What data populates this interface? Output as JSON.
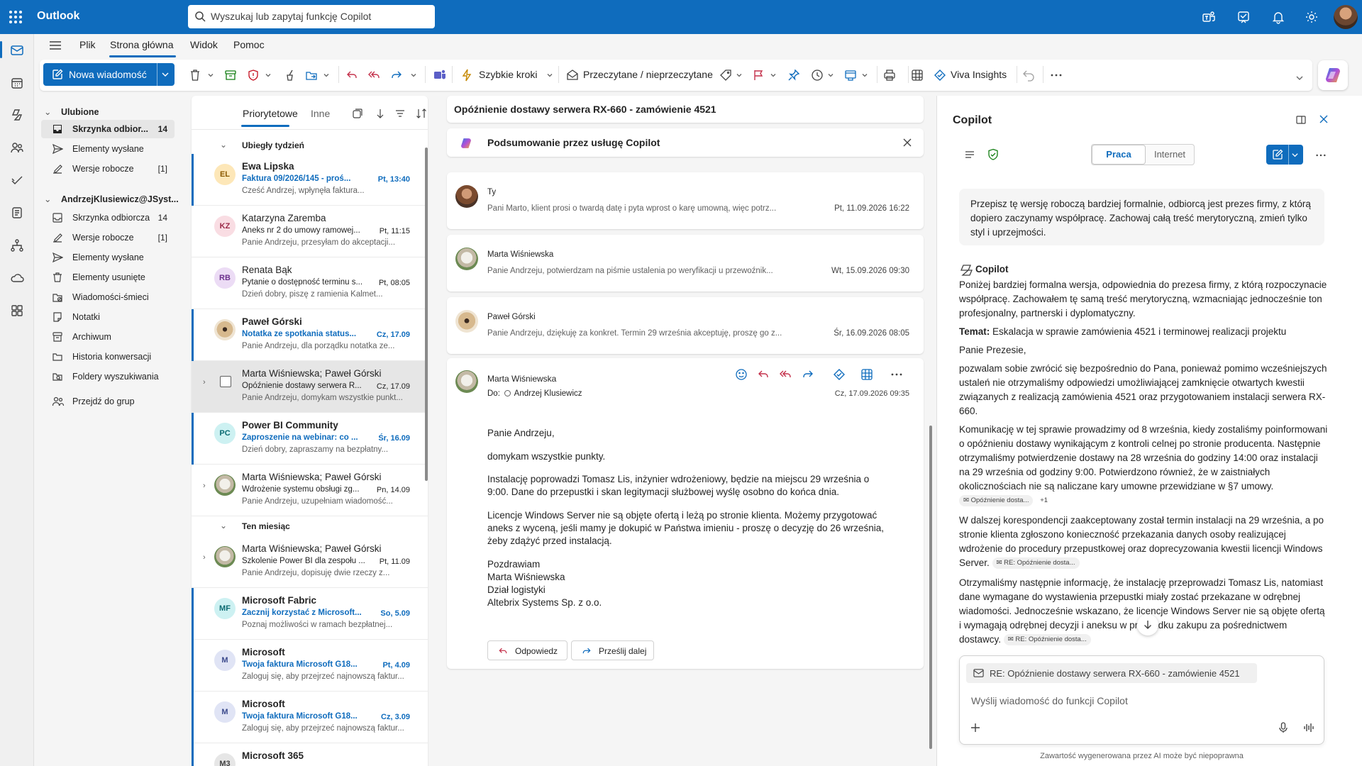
{
  "app": {
    "title": "Outlook"
  },
  "search": {
    "placeholder": "Wyszukaj lub zapytaj funkcję Copilot"
  },
  "menu": {
    "items": [
      "Plik",
      "Strona główna",
      "Widok",
      "Pomoc"
    ],
    "active": "Strona główna"
  },
  "ribbon": {
    "new_message": "Nowa wiadomość",
    "quick_steps": "Szybkie kroki",
    "read_unread": "Przeczytane / nieprzeczytane",
    "viva": "Viva Insights"
  },
  "folders": {
    "favorites_title": "Ulubione",
    "favorites": [
      {
        "label": "Skrzynka odbior...",
        "count": "14"
      },
      {
        "label": "Elementy wysłane",
        "count": ""
      },
      {
        "label": "Wersje robocze",
        "count": "[1]"
      }
    ],
    "account_title": "AndrzejKlusiewicz@JSyst...",
    "account": [
      {
        "label": "Skrzynka odbiorcza",
        "count": "14"
      },
      {
        "label": "Wersje robocze",
        "count": "[1]"
      },
      {
        "label": "Elementy wysłane",
        "count": ""
      },
      {
        "label": "Elementy usunięte",
        "count": ""
      },
      {
        "label": "Wiadomości-śmieci",
        "count": ""
      },
      {
        "label": "Notatki",
        "count": ""
      },
      {
        "label": "Archiwum",
        "count": ""
      },
      {
        "label": "Historia konwersacji",
        "count": ""
      },
      {
        "label": "Foldery wyszukiwania",
        "count": ""
      }
    ],
    "groups": "Przejdź do grup"
  },
  "list": {
    "tabs": [
      "Priorytetowe",
      "Inne"
    ],
    "group_last_week": "Ubiegły tydzień",
    "group_this_month": "Ten miesiąc",
    "messages": [
      {
        "initials": "EL",
        "avatar_bg": "#fde7b8",
        "avatar_fg": "#8a5a00",
        "from": "Ewa Lipska",
        "subject": "Faktura 09/2026/145 - proś...",
        "date": "Pt, 13:40",
        "preview": "Cześć Andrzej, wpłynęła faktura...",
        "unread": true
      },
      {
        "initials": "KZ",
        "avatar_bg": "#f9dde3",
        "avatar_fg": "#9c2c4a",
        "from": "Katarzyna Zaremba",
        "subject": "Aneks nr 2 do umowy ramowej...",
        "date": "Pt, 11:15",
        "preview": "Panie Andrzeju, przesyłam do akceptacji...",
        "unread": false
      },
      {
        "initials": "RB",
        "avatar_bg": "#ecdcf5",
        "avatar_fg": "#6b2f8c",
        "from": "Renata Bąk",
        "subject": "Pytanie o dostępność terminu s...",
        "date": "Pt, 08:05",
        "preview": "Dzień dobry, piszę z ramienia Kalmet...",
        "unread": false
      },
      {
        "initials": "",
        "avatar_bg": "",
        "avatar_fg": "",
        "from": "Paweł Górski",
        "subject": "Notatka ze spotkania status...",
        "date": "Cz, 17.09",
        "preview": "Panie Andrzeju, dla porządku notatka ze...",
        "unread": true
      },
      {
        "initials": "",
        "avatar_bg": "",
        "avatar_fg": "",
        "from": "Marta Wiśniewska; Paweł Górski",
        "subject": "Opóźnienie dostawy serwera R...",
        "date": "Cz, 17.09",
        "preview": "Panie Andrzeju, domykam wszystkie punkt...",
        "unread": false
      },
      {
        "initials": "PC",
        "avatar_bg": "#cdf1f2",
        "avatar_fg": "#0a6b72",
        "from": "Power BI Community",
        "subject": "Zaproszenie na webinar: co ...",
        "date": "Śr, 16.09",
        "preview": "Dzień dobry, zapraszamy na bezpłatny...",
        "unread": true
      },
      {
        "initials": "",
        "avatar_bg": "",
        "avatar_fg": "",
        "from": "Marta Wiśniewska; Paweł Górski",
        "subject": "Wdrożenie systemu obsługi zg...",
        "date": "Pn, 14.09",
        "preview": "Panie Andrzeju, uzupełniam wiadomość...",
        "unread": false
      },
      {
        "initials": "",
        "avatar_bg": "",
        "avatar_fg": "",
        "from": "Marta Wiśniewska; Paweł Górski",
        "subject": "Szkolenie Power BI dla zespołu ...",
        "date": "Pt, 11.09",
        "preview": "Panie Andrzeju, dopisuję dwie rzeczy z...",
        "unread": false
      },
      {
        "initials": "MF",
        "avatar_bg": "#cdf1f2",
        "avatar_fg": "#0a6b72",
        "from": "Microsoft Fabric",
        "subject": "Zacznij korzystać z Microsoft...",
        "date": "So, 5.09",
        "preview": "Poznaj możliwości w ramach bezpłatnej...",
        "unread": true
      },
      {
        "initials": "M",
        "avatar_bg": "#e0e4f5",
        "avatar_fg": "#3b4a8c",
        "from": "Microsoft",
        "subject": "Twoja faktura Microsoft G18...",
        "date": "Pt, 4.09",
        "preview": "Zaloguj się, aby przejrzeć najnowszą faktur...",
        "unread": true
      },
      {
        "initials": "M",
        "avatar_bg": "#e0e4f5",
        "avatar_fg": "#3b4a8c",
        "from": "Microsoft",
        "subject": "Twoja faktura Microsoft G18...",
        "date": "Cz, 3.09",
        "preview": "Zaloguj się, aby przejrzeć najnowszą faktur...",
        "unread": true
      },
      {
        "initials": "M3",
        "avatar_bg": "#e6e6e6",
        "avatar_fg": "#424242",
        "from": "Microsoft 365",
        "subject": "",
        "date": "",
        "preview": "",
        "unread": true
      }
    ]
  },
  "reading": {
    "subject": "Opóźnienie dostawy serwera RX-660 - zamówienie 4521",
    "summary": "Podsumowanie przez usługę Copilot",
    "thread": [
      {
        "from": "Ty",
        "preview": "Pani Marto, klient prosi o twardą datę i pyta wprost o karę umowną, więc potrz...",
        "date": "Pt, 11.09.2026 16:22"
      },
      {
        "from": "Marta Wiśniewska",
        "preview": "Panie Andrzeju, potwierdzam na piśmie ustalenia po weryfikacji u przewoźnik...",
        "date": "Wt, 15.09.2026 09:30"
      },
      {
        "from": "Paweł Górski",
        "preview": "Panie Andrzeju, dziękuję za konkret. Termin 29 września akceptuję, proszę go z...",
        "date": "Śr, 16.09.2026 08:05"
      }
    ],
    "open": {
      "from": "Marta Wiśniewska",
      "to_label": "Do:",
      "to": "Andrzej Klusiewicz",
      "date": "Cz, 17.09.2026 09:35",
      "body": [
        "Panie Andrzeju,",
        "domykam wszystkie punkty.",
        "Instalację poprowadzi Tomasz Lis, inżynier wdrożeniowy, będzie na miejscu 29 września o",
        "9:00. Dane do przepustki i skan legitymacji służbowej wyślę osobno do końca dnia.",
        "Licencje Windows Server nie są objęte ofertą i leżą po stronie klienta. Możemy przygotować",
        "aneks z wyceną, jeśli mamy je dokupić w Państwa imieniu - proszę o decyzję do 26 września,",
        "żeby zdążyć przed instalacją.",
        "Pozdrawiam",
        "Marta Wiśniewska",
        "Dział logistyki",
        "Altebrix Systems Sp. z o.o."
      ],
      "reply": "Odpowiedz",
      "forward": "Prześlij dalej"
    }
  },
  "copilot": {
    "title": "Copilot",
    "toggle_work": "Praca",
    "toggle_web": "Internet",
    "user_prompt": "Przepisz tę wersję roboczą bardziej formalnie, odbiorcą jest prezes firmy, z którą dopiero zaczynamy współpracę. Zachowaj całą treść merytoryczną, zmień tylko styl i uprzejmości.",
    "bot_name": "Copilot",
    "intro": "Poniżej bardziej formalna wersja, odpowiednia do prezesa firmy, z którą rozpoczynacie współpracę. Zachowałem tę samą treść merytoryczną, wzmacniając jednocześnie ton profesjonalny, partnerski i dyplomatyczny.",
    "topic_label": "Temat:",
    "topic": "Eskalacja w sprawie zamówienia 4521 i terminowej realizacji projektu",
    "greeting": "Panie Prezesie,",
    "p1": "pozwalam sobie zwrócić się bezpośrednio do Pana, ponieważ pomimo wcześniejszych ustaleń nie otrzymaliśmy odpowiedzi umożliwiającej zamknięcie otwartych kwestii związanych z realizacją zamówienia 4521 oraz przygotowaniem instalacji serwera RX-660.",
    "p2": "Komunikację w tej sprawie prowadzimy od 8 września, kiedy zostaliśmy poinformowani o opóźnieniu dostawy wynikającym z kontroli celnej po stronie producenta. Następnie otrzymaliśmy potwierdzenie dostawy na 28 września do godziny 14:00 oraz instalacji na 29 września od godziny 9:00. Potwierdzono również, że w zaistniałych okolicznościach nie są naliczane kary umowne przewidziane w §7 umowy.",
    "p2_chip": "Opóźnienie dosta...",
    "p2_chip_more": "+1",
    "p3": "W dalszej korespondencji zaakceptowany został termin instalacji na 29 września, a po stronie klienta zgłoszono konieczność przekazania danych osoby realizującej wdrożenie do procedury przepustkowej oraz doprecyzowania kwestii licencji Windows Server.",
    "p3_chip": "RE: Opóźnienie dosta...",
    "p4": "Otrzymaliśmy następnie informację, że instalację przeprowadzi Tomasz Lis, natomiast dane wymagane do wystawienia przepustki miały zostać przekazane w odrębnej wiadomości. Jednocześnie wskazano, że licencje Windows Server nie są objęte ofertą i wymagają odrębnej decyzji i aneksu w przypadku zakupu za pośrednictwem dostawcy.",
    "p4_chip": "RE: Opóźnienie dosta...",
    "ref_chip": "RE: Opóźnienie dostawy serwera RX-660 - zamówienie 4521",
    "input_placeholder": "Wyślij wiadomość do funkcji Copilot",
    "disclaimer": "Zawartość wygenerowana przez AI może być niepoprawna"
  }
}
